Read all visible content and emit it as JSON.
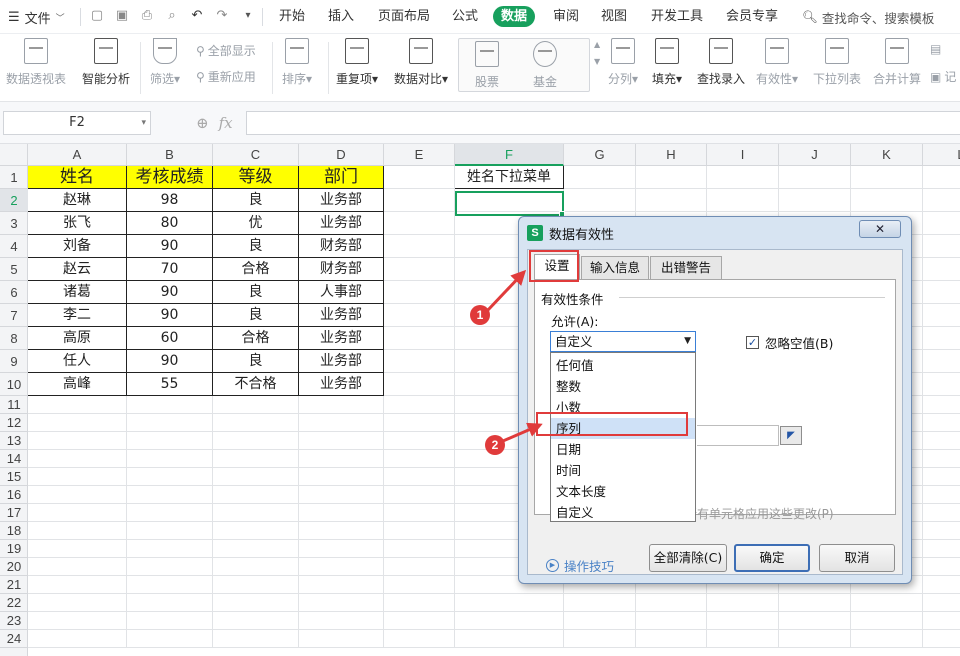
{
  "menubar": {
    "file_label": "文件",
    "tabs": [
      "开始",
      "插入",
      "页面布局",
      "公式",
      "数据",
      "审阅",
      "视图",
      "开发工具",
      "会员专享"
    ],
    "active_tab": "数据",
    "search_placeholder": "查找命令、搜索模板"
  },
  "ribbon": {
    "pivot": "数据透视表",
    "smart_analysis": "智能分析",
    "filter": "筛选",
    "show_all": "全部显示",
    "reapply": "重新应用",
    "sort": "排序",
    "duplicates": "重复项",
    "compare": "数据对比",
    "stocks": "股票",
    "funds": "基金",
    "split_column": "分列",
    "fill": "填充",
    "lookup_entry": "查找录入",
    "validation": "有效性",
    "dropdown_list": "下拉列表",
    "consolidate": "合并计算",
    "record_trunc": "记"
  },
  "formula_bar": {
    "name_box": "F2",
    "fx": "fx",
    "formula": ""
  },
  "sheet": {
    "columns": [
      "A",
      "B",
      "C",
      "D",
      "E",
      "F",
      "G",
      "H",
      "I",
      "J",
      "K",
      "L"
    ],
    "selected_column": "F",
    "rows": [
      "1",
      "2",
      "3",
      "4",
      "5",
      "6",
      "7",
      "8",
      "9",
      "10",
      "11",
      "12",
      "13",
      "14",
      "15",
      "16",
      "17",
      "18",
      "19",
      "20",
      "21",
      "22",
      "23",
      "24"
    ],
    "selected_row": "2",
    "headers": [
      "姓名",
      "考核成绩",
      "等级",
      "部门"
    ],
    "data": [
      [
        "赵琳",
        "98",
        "良",
        "业务部"
      ],
      [
        "张飞",
        "80",
        "优",
        "业务部"
      ],
      [
        "刘备",
        "90",
        "良",
        "财务部"
      ],
      [
        "赵云",
        "70",
        "合格",
        "财务部"
      ],
      [
        "诸葛",
        "90",
        "良",
        "人事部"
      ],
      [
        "李二",
        "90",
        "良",
        "业务部"
      ],
      [
        "高原",
        "60",
        "合格",
        "业务部"
      ],
      [
        "任人",
        "90",
        "良",
        "业务部"
      ],
      [
        "高峰",
        "55",
        "不合格",
        "业务部"
      ]
    ],
    "f1_label": "姓名下拉菜单",
    "f2_value": ""
  },
  "dialog": {
    "title": "数据有效性",
    "close": "✕",
    "tabs": [
      "设置",
      "输入信息",
      "出错警告"
    ],
    "active_tab": "设置",
    "group_label": "有效性条件",
    "allow_label": "允许(A):",
    "allow_value": "自定义",
    "ignore_blank_label": "忽略空值(B)",
    "ignore_blank_checked": true,
    "allow_options": [
      "任何值",
      "整数",
      "小数",
      "序列",
      "日期",
      "时间",
      "文本长度",
      "自定义"
    ],
    "highlighted_option": "序列",
    "apply_all_label": "所有单元格应用这些更改(P)",
    "tips_label": "操作技巧",
    "clear_all": "全部清除(C)",
    "ok": "确定",
    "cancel": "取消"
  },
  "annotations": {
    "step1": "1",
    "step2": "2"
  },
  "colors": {
    "accent": "#17a05d",
    "header_fill": "#ffff00",
    "annotation_red": "#e03b3b",
    "dialog_frame": "#d7e4f2"
  }
}
